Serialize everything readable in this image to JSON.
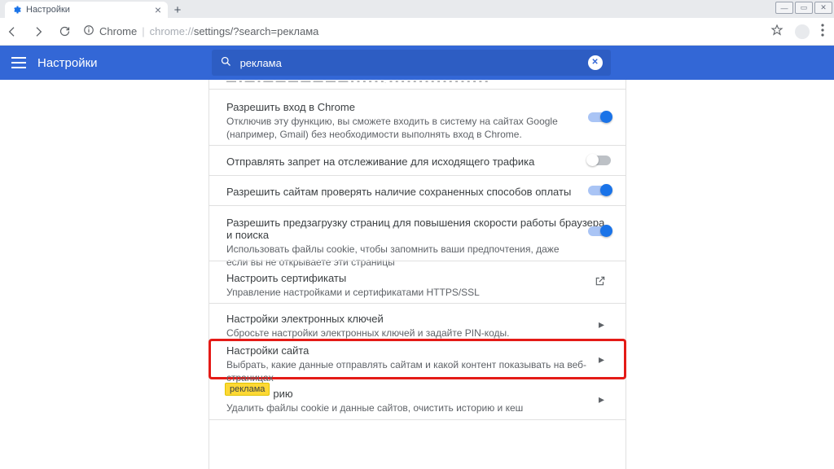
{
  "window": {
    "tab_title": "Настройки"
  },
  "toolbar": {
    "addr_prefix": "Chrome",
    "addr_domain": "chrome://",
    "addr_path": "settings/?search=реклама"
  },
  "header": {
    "title": "Настройки",
    "search_value": "реклама"
  },
  "rows": {
    "truncated": "— - — - — — — — — — — - - - - - -, - - - - - - - - - - - - - - - - -",
    "chrome_signin": {
      "title": "Разрешить вход в Chrome",
      "desc": "Отключив эту функцию, вы сможете входить в систему на сайтах Google (например, Gmail) без необходимости выполнять вход в Chrome."
    },
    "dnt": {
      "title": "Отправлять запрет на отслеживание для исходящего трафика"
    },
    "payments": {
      "title": "Разрешить сайтам проверять наличие сохраненных способов оплаты"
    },
    "preload": {
      "title": "Разрешить предзагрузку страниц для повышения скорости работы браузера и поиска",
      "desc": "Использовать файлы cookie, чтобы запомнить ваши предпочтения, даже если вы не открываете эти страницы"
    },
    "certs": {
      "title": "Настроить сертификаты",
      "desc": "Управление настройками и сертификатами HTTPS/SSL"
    },
    "keys": {
      "title": "Настройки электронных ключей",
      "desc": "Сбросьте настройки электронных ключей и задайте PIN-коды."
    },
    "site": {
      "title": "Настройки сайта",
      "desc": "Выбрать, какие данные отправлять сайтам и какой контент показывать на веб-страницах"
    },
    "clear": {
      "title_suffix": "рию",
      "desc": "Удалить файлы cookie и данные сайтов, очистить историю и кеш"
    }
  },
  "highlight": {
    "text": "реклама"
  }
}
